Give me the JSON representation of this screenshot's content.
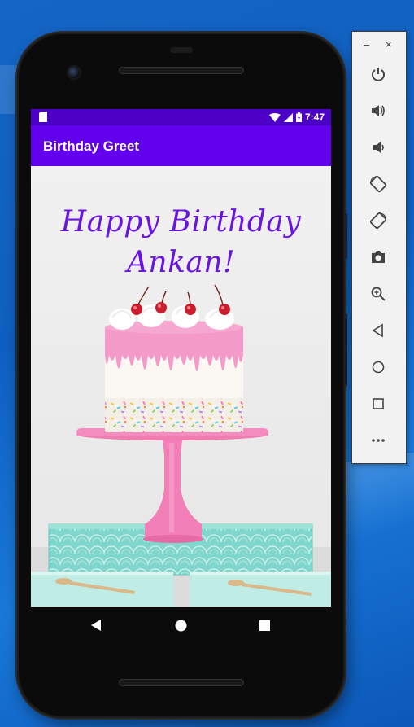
{
  "status_bar": {
    "time": "7:47"
  },
  "app_bar": {
    "title": "Birthday Greet"
  },
  "greeting": {
    "line1": "Happy Birthday",
    "line2": "Ankan!"
  },
  "emulator_panel": {
    "minimize_label": "–",
    "close_label": "×",
    "buttons": [
      "power-icon",
      "volume-up-icon",
      "volume-down-icon",
      "rotate-left-icon",
      "rotate-right-icon",
      "camera-icon",
      "zoom-icon",
      "back-icon",
      "home-icon",
      "overview-icon",
      "more-icon"
    ]
  },
  "colors": {
    "status_bar": "#4c00c6",
    "app_bar": "#6200ee",
    "greeting_text": "#6a14e0"
  }
}
